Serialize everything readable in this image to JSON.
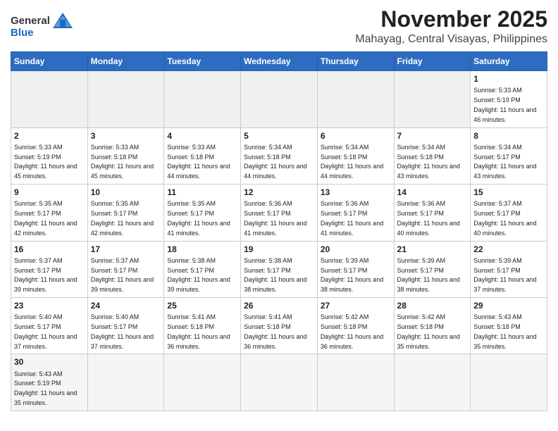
{
  "header": {
    "logo_general": "General",
    "logo_blue": "Blue",
    "month_title": "November 2025",
    "location": "Mahayag, Central Visayas, Philippines"
  },
  "weekdays": [
    "Sunday",
    "Monday",
    "Tuesday",
    "Wednesday",
    "Thursday",
    "Friday",
    "Saturday"
  ],
  "days": [
    {
      "date": "",
      "empty": true
    },
    {
      "date": "",
      "empty": true
    },
    {
      "date": "",
      "empty": true
    },
    {
      "date": "",
      "empty": true
    },
    {
      "date": "",
      "empty": true
    },
    {
      "date": "",
      "empty": true
    },
    {
      "date": "1",
      "sunrise": "Sunrise: 5:33 AM",
      "sunset": "Sunset: 5:19 PM",
      "daylight": "Daylight: 11 hours and 46 minutes."
    },
    {
      "date": "2",
      "sunrise": "Sunrise: 5:33 AM",
      "sunset": "Sunset: 5:19 PM",
      "daylight": "Daylight: 11 hours and 45 minutes."
    },
    {
      "date": "3",
      "sunrise": "Sunrise: 5:33 AM",
      "sunset": "Sunset: 5:18 PM",
      "daylight": "Daylight: 11 hours and 45 minutes."
    },
    {
      "date": "4",
      "sunrise": "Sunrise: 5:33 AM",
      "sunset": "Sunset: 5:18 PM",
      "daylight": "Daylight: 11 hours and 44 minutes."
    },
    {
      "date": "5",
      "sunrise": "Sunrise: 5:34 AM",
      "sunset": "Sunset: 5:18 PM",
      "daylight": "Daylight: 11 hours and 44 minutes."
    },
    {
      "date": "6",
      "sunrise": "Sunrise: 5:34 AM",
      "sunset": "Sunset: 5:18 PM",
      "daylight": "Daylight: 11 hours and 44 minutes."
    },
    {
      "date": "7",
      "sunrise": "Sunrise: 5:34 AM",
      "sunset": "Sunset: 5:18 PM",
      "daylight": "Daylight: 11 hours and 43 minutes."
    },
    {
      "date": "8",
      "sunrise": "Sunrise: 5:34 AM",
      "sunset": "Sunset: 5:17 PM",
      "daylight": "Daylight: 11 hours and 43 minutes."
    },
    {
      "date": "9",
      "sunrise": "Sunrise: 5:35 AM",
      "sunset": "Sunset: 5:17 PM",
      "daylight": "Daylight: 11 hours and 42 minutes."
    },
    {
      "date": "10",
      "sunrise": "Sunrise: 5:35 AM",
      "sunset": "Sunset: 5:17 PM",
      "daylight": "Daylight: 11 hours and 42 minutes."
    },
    {
      "date": "11",
      "sunrise": "Sunrise: 5:35 AM",
      "sunset": "Sunset: 5:17 PM",
      "daylight": "Daylight: 11 hours and 41 minutes."
    },
    {
      "date": "12",
      "sunrise": "Sunrise: 5:36 AM",
      "sunset": "Sunset: 5:17 PM",
      "daylight": "Daylight: 11 hours and 41 minutes."
    },
    {
      "date": "13",
      "sunrise": "Sunrise: 5:36 AM",
      "sunset": "Sunset: 5:17 PM",
      "daylight": "Daylight: 11 hours and 41 minutes."
    },
    {
      "date": "14",
      "sunrise": "Sunrise: 5:36 AM",
      "sunset": "Sunset: 5:17 PM",
      "daylight": "Daylight: 11 hours and 40 minutes."
    },
    {
      "date": "15",
      "sunrise": "Sunrise: 5:37 AM",
      "sunset": "Sunset: 5:17 PM",
      "daylight": "Daylight: 11 hours and 40 minutes."
    },
    {
      "date": "16",
      "sunrise": "Sunrise: 5:37 AM",
      "sunset": "Sunset: 5:17 PM",
      "daylight": "Daylight: 11 hours and 39 minutes."
    },
    {
      "date": "17",
      "sunrise": "Sunrise: 5:37 AM",
      "sunset": "Sunset: 5:17 PM",
      "daylight": "Daylight: 11 hours and 39 minutes."
    },
    {
      "date": "18",
      "sunrise": "Sunrise: 5:38 AM",
      "sunset": "Sunset: 5:17 PM",
      "daylight": "Daylight: 11 hours and 39 minutes."
    },
    {
      "date": "19",
      "sunrise": "Sunrise: 5:38 AM",
      "sunset": "Sunset: 5:17 PM",
      "daylight": "Daylight: 11 hours and 38 minutes."
    },
    {
      "date": "20",
      "sunrise": "Sunrise: 5:39 AM",
      "sunset": "Sunset: 5:17 PM",
      "daylight": "Daylight: 11 hours and 38 minutes."
    },
    {
      "date": "21",
      "sunrise": "Sunrise: 5:39 AM",
      "sunset": "Sunset: 5:17 PM",
      "daylight": "Daylight: 11 hours and 38 minutes."
    },
    {
      "date": "22",
      "sunrise": "Sunrise: 5:39 AM",
      "sunset": "Sunset: 5:17 PM",
      "daylight": "Daylight: 11 hours and 37 minutes."
    },
    {
      "date": "23",
      "sunrise": "Sunrise: 5:40 AM",
      "sunset": "Sunset: 5:17 PM",
      "daylight": "Daylight: 11 hours and 37 minutes."
    },
    {
      "date": "24",
      "sunrise": "Sunrise: 5:40 AM",
      "sunset": "Sunset: 5:17 PM",
      "daylight": "Daylight: 11 hours and 37 minutes."
    },
    {
      "date": "25",
      "sunrise": "Sunrise: 5:41 AM",
      "sunset": "Sunset: 5:18 PM",
      "daylight": "Daylight: 11 hours and 36 minutes."
    },
    {
      "date": "26",
      "sunrise": "Sunrise: 5:41 AM",
      "sunset": "Sunset: 5:18 PM",
      "daylight": "Daylight: 11 hours and 36 minutes."
    },
    {
      "date": "27",
      "sunrise": "Sunrise: 5:42 AM",
      "sunset": "Sunset: 5:18 PM",
      "daylight": "Daylight: 11 hours and 36 minutes."
    },
    {
      "date": "28",
      "sunrise": "Sunrise: 5:42 AM",
      "sunset": "Sunset: 5:18 PM",
      "daylight": "Daylight: 11 hours and 35 minutes."
    },
    {
      "date": "29",
      "sunrise": "Sunrise: 5:43 AM",
      "sunset": "Sunset: 5:18 PM",
      "daylight": "Daylight: 11 hours and 35 minutes."
    },
    {
      "date": "30",
      "sunrise": "Sunrise: 5:43 AM",
      "sunset": "Sunset: 5:19 PM",
      "daylight": "Daylight: 11 hours and 35 minutes."
    }
  ]
}
